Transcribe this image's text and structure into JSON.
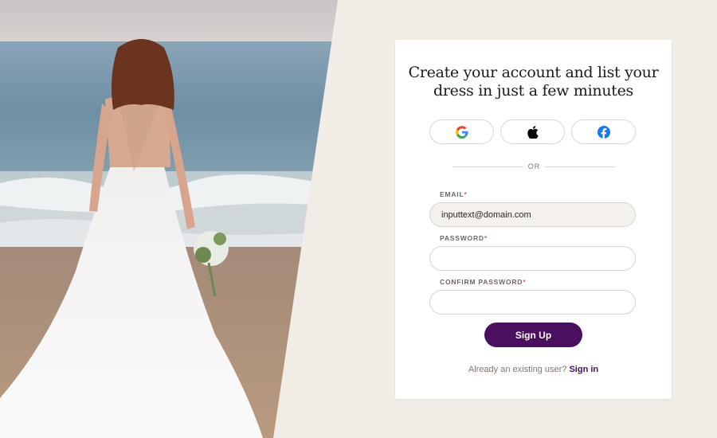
{
  "hero": {
    "image": "bride-on-beach-photo"
  },
  "signup": {
    "heading_line1": "Create your account and list your",
    "heading_line2": "dress in just a few minutes",
    "social": [
      {
        "icon": "google-icon"
      },
      {
        "icon": "apple-icon"
      },
      {
        "icon": "facebook-icon"
      }
    ],
    "divider_text": "OR",
    "email_label": "EMAIL",
    "email_value": "inputtext@domain.com",
    "password_label": "PASSWORD",
    "password_value": "",
    "confirm_label": "CONFIRM PASSWORD",
    "confirm_value": "",
    "required_mark": "*",
    "submit_label": "Sign Up",
    "existing_prompt": "Already an existing user?",
    "signin_link": "Sign in"
  },
  "colors": {
    "background": "#f2ece6",
    "accent": "#4b0f5f",
    "card": "#ffffff"
  }
}
